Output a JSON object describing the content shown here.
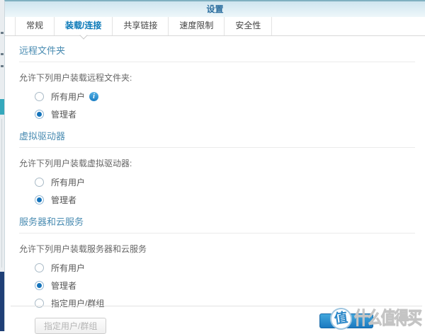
{
  "window": {
    "title": "设置"
  },
  "tabs": [
    {
      "label": "常规",
      "active": false
    },
    {
      "label": "装载/连接",
      "active": true
    },
    {
      "label": "共享链接",
      "active": false
    },
    {
      "label": "速度限制",
      "active": false
    },
    {
      "label": "安全性",
      "active": false
    }
  ],
  "sections": [
    {
      "title": "远程文件夹",
      "description": "允许下列用户装载远程文件夹:",
      "options": [
        {
          "label": "所有用户",
          "selected": false,
          "info": true
        },
        {
          "label": "管理者",
          "selected": true,
          "info": false
        }
      ]
    },
    {
      "title": "虚拟驱动器",
      "description": "允许下列用户装载虚拟驱动器:",
      "options": [
        {
          "label": "所有用户",
          "selected": false,
          "info": false
        },
        {
          "label": "管理者",
          "selected": true,
          "info": false
        }
      ]
    },
    {
      "title": "服务器和云服务",
      "description": "允许下列用户装载服务器和云服务",
      "options": [
        {
          "label": "所有用户",
          "selected": false,
          "info": false
        },
        {
          "label": "管理者",
          "selected": true,
          "info": false
        },
        {
          "label": "指定用户/群组",
          "selected": false,
          "info": false
        }
      ],
      "button": {
        "label": "指定用户/群组",
        "disabled": true
      }
    }
  ],
  "watermark": {
    "badge": "值",
    "text": "什么值得买"
  },
  "colors": {
    "accent": "#1473bb",
    "tab_active": "#0b79b8",
    "section_title": "#4a8cb2",
    "header_title": "#2a6d9e",
    "ok_button_top": "#42a7dd",
    "ok_button_bottom": "#1a79c0",
    "strip_teal": "#35a8bc",
    "strip_navy": "#1f3f76"
  }
}
